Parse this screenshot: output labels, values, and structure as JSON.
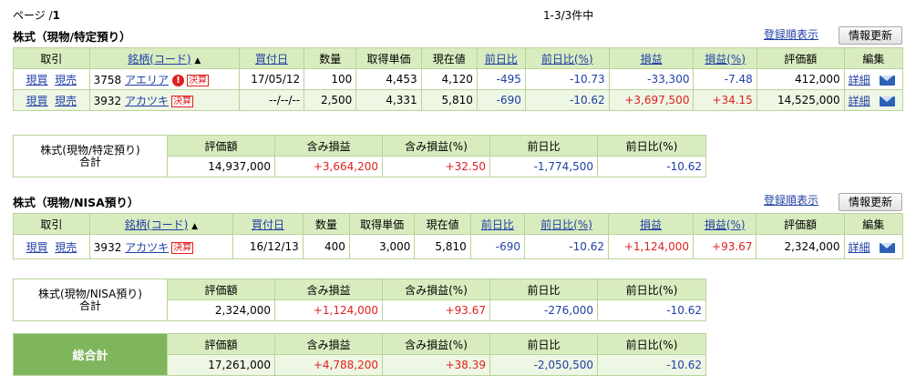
{
  "page": {
    "label": "ページ /",
    "number": "1",
    "count": "1-3/3件中"
  },
  "header_links": {
    "order": "登録順表示",
    "refresh": "情報更新"
  },
  "columns": [
    "取引",
    "銘柄(コード)",
    "買付日",
    "数量",
    "取得単価",
    "現在値",
    "前日比",
    "前日比(%)",
    "損益",
    "損益(%)",
    "評価額",
    "編集"
  ],
  "sort_mark": "▲",
  "trade_links": {
    "buy": "現買",
    "sell": "現売"
  },
  "edit_link": "詳細",
  "kessan_tag": "決算",
  "alert_mark": "!",
  "section1": {
    "title": "株式（現物/特定預り）",
    "rows": [
      {
        "code": "3758",
        "name": "アエリア",
        "alert": true,
        "tag": true,
        "date": "17/05/12",
        "qty": "100",
        "cost": "4,453",
        "price": "4,120",
        "chg": "-495",
        "chg_pct": "-10.73",
        "pl": "-33,300",
        "pl_pct": "-7.48",
        "value": "412,000"
      },
      {
        "code": "3932",
        "name": "アカツキ",
        "alert": false,
        "tag": true,
        "date": "--/--/--",
        "qty": "2,500",
        "cost": "4,331",
        "price": "5,810",
        "chg": "-690",
        "chg_pct": "-10.62",
        "pl": "+3,697,500",
        "pl_pct": "+34.15",
        "value": "14,525,000"
      }
    ],
    "summary": {
      "label1": "株式(現物/特定預り)",
      "label2": "合計",
      "value": "14,937,000",
      "unreal": "+3,664,200",
      "unreal_pct": "+32.50",
      "chg": "-1,774,500",
      "chg_pct": "-10.62"
    }
  },
  "section2": {
    "title": "株式（現物/NISA預り）",
    "rows": [
      {
        "code": "3932",
        "name": "アカツキ",
        "alert": false,
        "tag": true,
        "date": "16/12/13",
        "qty": "400",
        "cost": "3,000",
        "price": "5,810",
        "chg": "-690",
        "chg_pct": "-10.62",
        "pl": "+1,124,000",
        "pl_pct": "+93.67",
        "value": "2,324,000"
      }
    ],
    "summary": {
      "label1": "株式(現物/NISA預り)",
      "label2": "合計",
      "value": "2,324,000",
      "unreal": "+1,124,000",
      "unreal_pct": "+93.67",
      "chg": "-276,000",
      "chg_pct": "-10.62"
    }
  },
  "summary_headers": [
    "評価額",
    "含み損益",
    "含み損益(%)",
    "前日比",
    "前日比(%)"
  ],
  "grand_total": {
    "label": "総合計",
    "value": "17,261,000",
    "unreal": "+4,788,200",
    "unreal_pct": "+38.39",
    "chg": "-2,050,500",
    "chg_pct": "-10.62"
  },
  "colors": {
    "header_bg": "#d9ecbf",
    "border": "#b9d49a",
    "row_alt": "#eef6e4",
    "grand_label_bg": "#7fb55c",
    "positive": "#e02020",
    "negative": "#1f3fa6"
  }
}
